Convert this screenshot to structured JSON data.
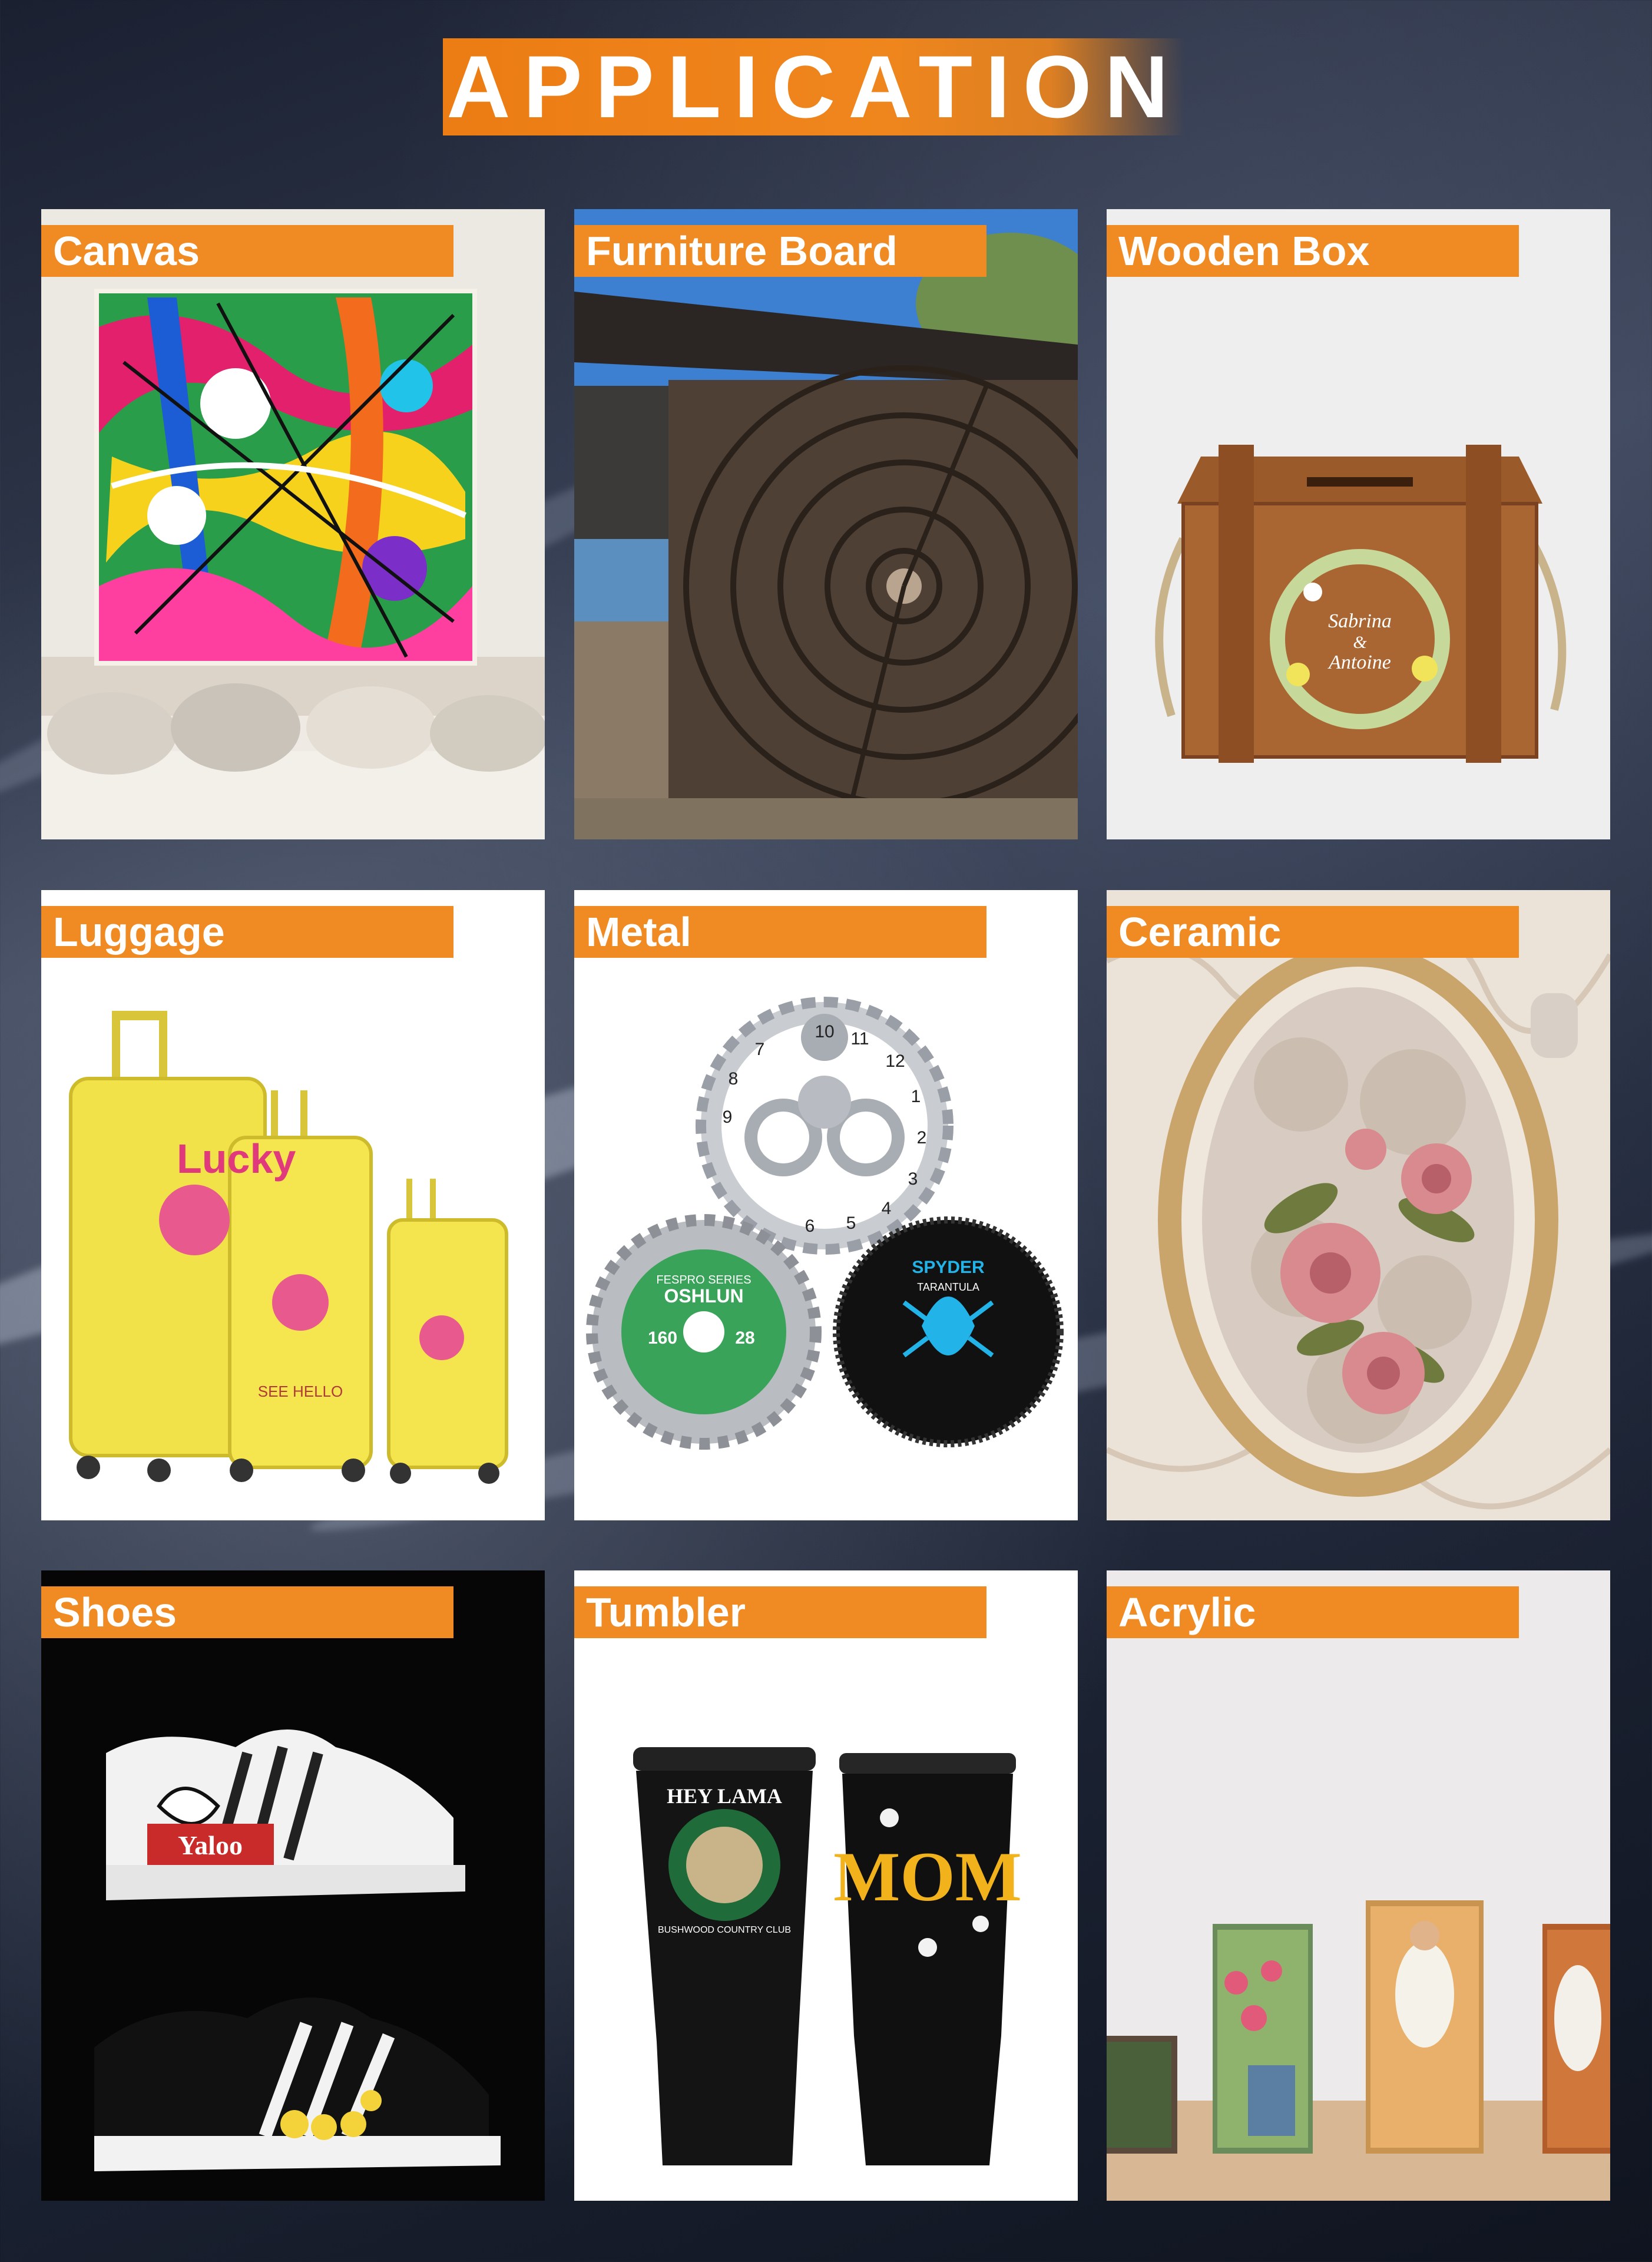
{
  "title": "APPLICATION",
  "tiles": [
    {
      "label": "Canvas"
    },
    {
      "label": "Furniture Board"
    },
    {
      "label": "Wooden Box"
    },
    {
      "label": "Luggage"
    },
    {
      "label": "Metal"
    },
    {
      "label": "Ceramic"
    },
    {
      "label": "Shoes"
    },
    {
      "label": "Tumbler"
    },
    {
      "label": "Acrylic"
    }
  ],
  "art_text": {
    "box_names_1": "Sabrina",
    "box_names_2": "&",
    "box_names_3": "Antoine",
    "luggage_text": "Lucky",
    "luggage_hello": "SEE HELLO",
    "clock_numbers": [
      "10",
      "11",
      "12",
      "1",
      "2",
      "3",
      "4",
      "5",
      "6",
      "7",
      "8",
      "9"
    ],
    "blade1_series": "FESPRO SERIES",
    "blade1_brand": "OSHLUN",
    "blade1_size": "160",
    "blade1_teeth": "28",
    "blade2_brand": "SPYDER",
    "blade2_model": "TARANTULA",
    "shoe_brand": "Yaloo",
    "tumbler1_text": "HEY LAMA",
    "tumbler1_club": "BUSHWOOD COUNTRY CLUB",
    "tumbler2_text": "MOM"
  },
  "colors": {
    "accent": "#f08a22",
    "title_orange": "#ec7c14"
  }
}
